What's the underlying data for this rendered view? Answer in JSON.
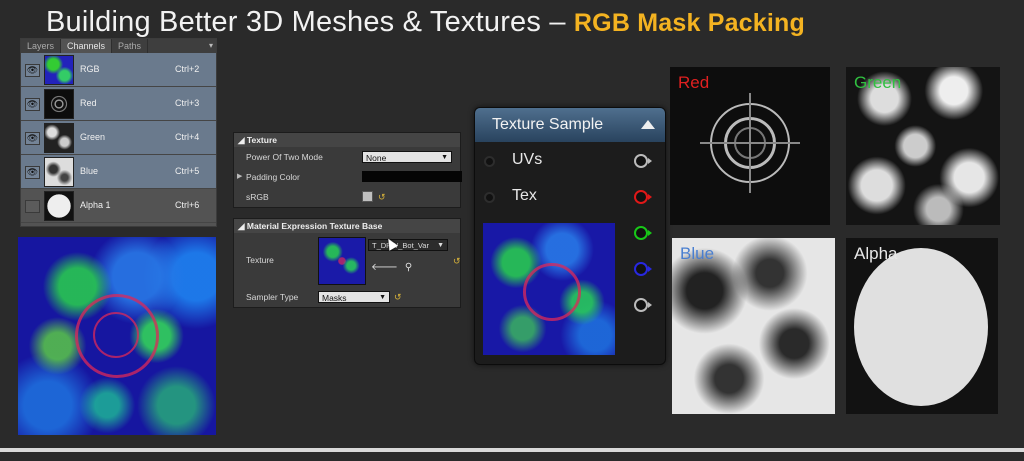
{
  "title": {
    "main": "Building Better 3D Meshes & Textures – ",
    "accent": "RGB Mask Packing"
  },
  "channels_panel": {
    "tabs": [
      "Layers",
      "Channels",
      "Paths"
    ],
    "active_tab": "Channels",
    "menu_icon": "panel-menu-icon",
    "rows": [
      {
        "name": "RGB",
        "shortcut": "Ctrl+2",
        "visible": true,
        "selected": true
      },
      {
        "name": "Red",
        "shortcut": "Ctrl+3",
        "visible": true,
        "selected": true
      },
      {
        "name": "Green",
        "shortcut": "Ctrl+4",
        "visible": true,
        "selected": true
      },
      {
        "name": "Blue",
        "shortcut": "Ctrl+5",
        "visible": true,
        "selected": true
      },
      {
        "name": "Alpha 1",
        "shortcut": "Ctrl+6",
        "visible": false,
        "selected": false
      }
    ]
  },
  "details": {
    "texture_section": {
      "header": "Texture",
      "power_of_two_label": "Power Of Two Mode",
      "power_of_two_value": "None",
      "padding_color_label": "Padding Color",
      "srgb_label": "sRGB"
    },
    "expression_section": {
      "header": "Material Expression Texture Base",
      "texture_label": "Texture",
      "texture_asset": "T_DPW_Bot_Var",
      "sampler_type_label": "Sampler Type",
      "sampler_type_value": "Masks"
    }
  },
  "node": {
    "title": "Texture Sample",
    "inputs": [
      "UVs",
      "Tex"
    ],
    "output_colors": [
      "#bbbbbb",
      "#e01818",
      "#18c818",
      "#2828e0",
      "#bbbbbb"
    ]
  },
  "channel_previews": {
    "red": {
      "label": "Red",
      "color": "#e02020"
    },
    "green": {
      "label": "Green",
      "color": "#30c040"
    },
    "blue": {
      "label": "Blue",
      "color": "#4a7fd0"
    },
    "alpha": {
      "label": "Alpha",
      "color": "#e8e8e8"
    }
  },
  "colors": {
    "accent": "#f4b321",
    "background": "#2a2a2a",
    "node_header": "#3d5a78"
  }
}
